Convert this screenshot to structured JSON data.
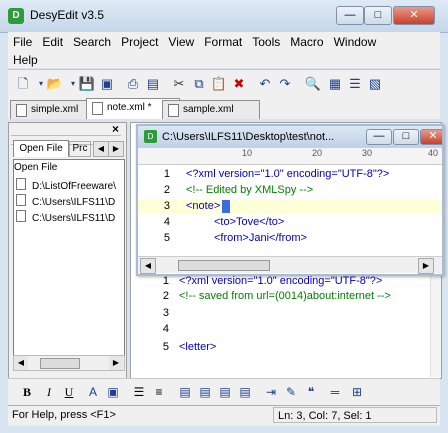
{
  "window": {
    "title": "DesyEdit v3.5",
    "minimize": "—",
    "maximize": "□",
    "close": "✕"
  },
  "menu": [
    "File",
    "Edit",
    "Search",
    "Project",
    "View",
    "Format",
    "Tools",
    "Macro",
    "Window",
    "Help"
  ],
  "tabs": [
    {
      "label": "simple.xml"
    },
    {
      "label": "note.xml *"
    },
    {
      "label": "sample.xml"
    }
  ],
  "left_panel": {
    "close": "×",
    "tab_open_file": "Open File",
    "tab_project": "Prc",
    "list_header": "Open File",
    "files": [
      "D:\\ListOfFreeware\\",
      "C:\\Users\\ILFS11\\D",
      "C:\\Users\\ILFS11\\D"
    ]
  },
  "child_window": {
    "title": "C:\\Users\\ILFS11\\Desktop\\test\\not...",
    "ruler_marks": [
      "10",
      "20",
      "30",
      "40"
    ],
    "lines": [
      {
        "n": "1",
        "text": "<?xml version=\"1.0\" encoding=\"UTF-8\"?>"
      },
      {
        "n": "2",
        "text": "<!-- Edited by XMLSpy -->"
      },
      {
        "n": "3",
        "text": "<note>"
      },
      {
        "n": "4",
        "text": "<to>Tove</to>"
      },
      {
        "n": "5",
        "text": "<from>Jani</from>"
      }
    ]
  },
  "editor": {
    "lines": [
      {
        "n": "1",
        "text": "<?xml version=\"1.0\" encoding=\"UTF-8\"?>"
      },
      {
        "n": "2",
        "text": "<!-- saved from url=(0014)about:internet -->"
      },
      {
        "n": "3",
        "text": ""
      },
      {
        "n": "4",
        "text": ""
      },
      {
        "n": "5",
        "text": "<letter>"
      }
    ]
  },
  "status": {
    "help": "For Help, press <F1>",
    "position": "Ln: 3, Col: 7, Sel: 1"
  }
}
